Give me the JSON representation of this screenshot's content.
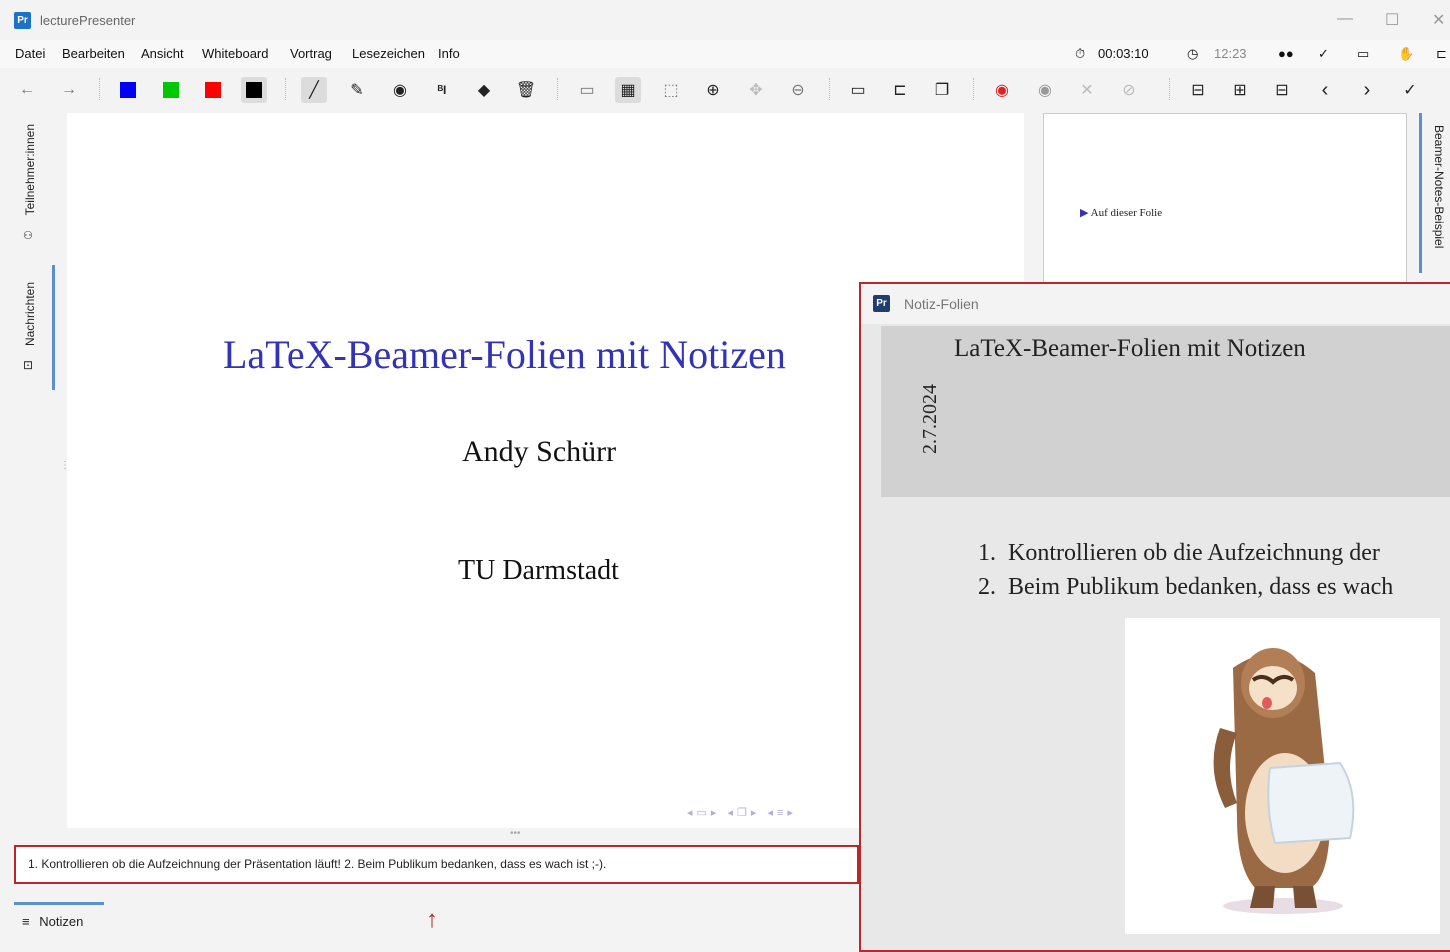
{
  "window": {
    "title": "lecturePresenter"
  },
  "menu": [
    "Datei",
    "Bearbeiten",
    "Ansicht",
    "Whiteboard",
    "Vortrag",
    "Lesezeichen",
    "Info"
  ],
  "status": {
    "timer": "00:03:10",
    "clock": "12:23"
  },
  "colors": {
    "blue": "#0000ff",
    "green": "#00c800",
    "red": "#ff0000",
    "black": "#000000",
    "accent": "#b9262c",
    "slide_title": "#3333b3"
  },
  "sidebar": {
    "participants": "Teilnehmer:innen",
    "messages": "Nachrichten"
  },
  "slide": {
    "title": "LaTeX-Beamer-Folien mit Notizen",
    "author": "Andy Schürr",
    "institute": "TU Darmstadt"
  },
  "notes": {
    "text": "1. Kontrollieren ob die Aufzeichnung der Präsentation läuft! 2. Beim Publikum bedanken, dass es wach ist ;-).",
    "tab_label": "Notizen"
  },
  "preview": {
    "bullet": "Auf dieser Folie",
    "side_tab": "Beamer-Notes-Beispiel"
  },
  "notes_window": {
    "title": "Notiz-Folien",
    "slide_title": "LaTeX-Beamer-Folien mit Notizen",
    "date": "2.7.2024",
    "items": [
      "Kontrollieren ob die Aufzeichnung der",
      "Beim Publikum bedanken, dass es wach"
    ]
  }
}
